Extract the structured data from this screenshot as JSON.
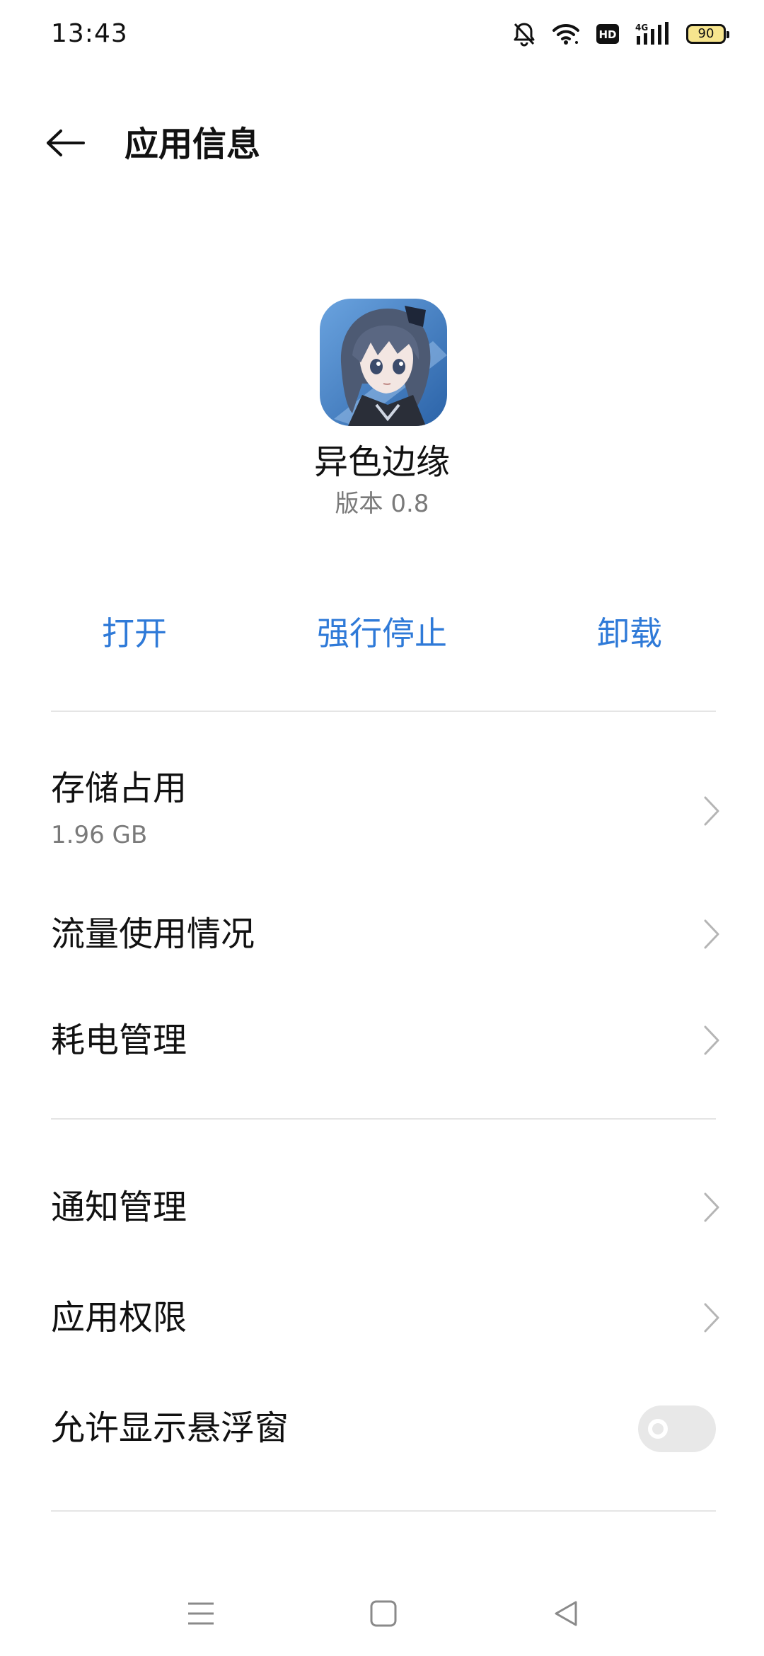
{
  "status_bar": {
    "time": "13:43",
    "battery": "90",
    "icons": [
      "bell-off-icon",
      "wifi-icon",
      "hd-icon",
      "signal-4g-icon",
      "battery-icon"
    ]
  },
  "header": {
    "back_icon": "arrow-left-icon",
    "title": "应用信息"
  },
  "app": {
    "name": "异色边缘",
    "version": "版本 0.8"
  },
  "actions": {
    "open": "打开",
    "force_stop": "强行停止",
    "uninstall": "卸载"
  },
  "rows": {
    "storage": {
      "title": "存储占用",
      "value": "1.96 GB"
    },
    "data_usage": {
      "title": "流量使用情况"
    },
    "battery": {
      "title": "耗电管理"
    },
    "notifications": {
      "title": "通知管理"
    },
    "permissions": {
      "title": "应用权限"
    },
    "floating_window": {
      "title": "允许显示悬浮窗",
      "enabled": false
    }
  },
  "nav_bar": {
    "icons": [
      "menu-icon",
      "home-icon",
      "back-icon"
    ]
  },
  "colors": {
    "accent": "#2f7ad8",
    "secondary_text": "#7a7a7a",
    "divider": "#e5e5e5",
    "toggle_off": "#e8e8e8"
  }
}
